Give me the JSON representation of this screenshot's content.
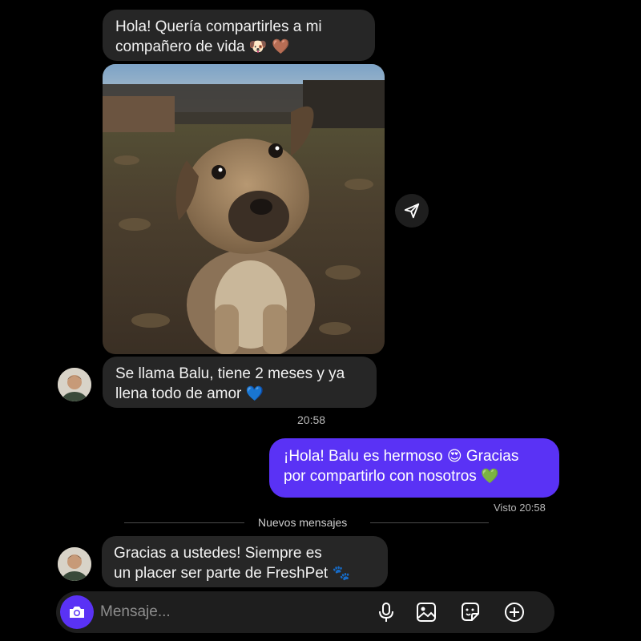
{
  "messages": {
    "m1_line1": "Hola! Quería compartirles a mi",
    "m1_line2": "compañero de vida",
    "m1_emoji": "🐶 🤎",
    "m2_line1": "Se llama Balu, tiene 2 meses y ya",
    "m2_line2": "llena todo de amor",
    "m2_emoji": "💙",
    "time1": "20:58",
    "out_line1_a": "¡Hola! Balu es hermoso",
    "out_emoji1": "😍",
    "out_line1_b": "Gracias",
    "out_line2": "por compartirlo con nosotros",
    "out_emoji2": "💚",
    "seen": "Visto 20:58",
    "new_divider": "Nuevos mensajes",
    "m3_line1": "Gracias a ustedes! Siempre es",
    "m3_line2": "un placer ser parte de FreshPet",
    "m3_emoji": "🐾"
  },
  "composer": {
    "placeholder": "Mensaje..."
  },
  "icons": [
    "send-share-icon",
    "camera-icon",
    "microphone-icon",
    "gallery-icon",
    "sticker-icon",
    "add-icon"
  ],
  "colors": {
    "outgoing": "#5a32f5",
    "incoming": "#262626",
    "background": "#000000"
  }
}
